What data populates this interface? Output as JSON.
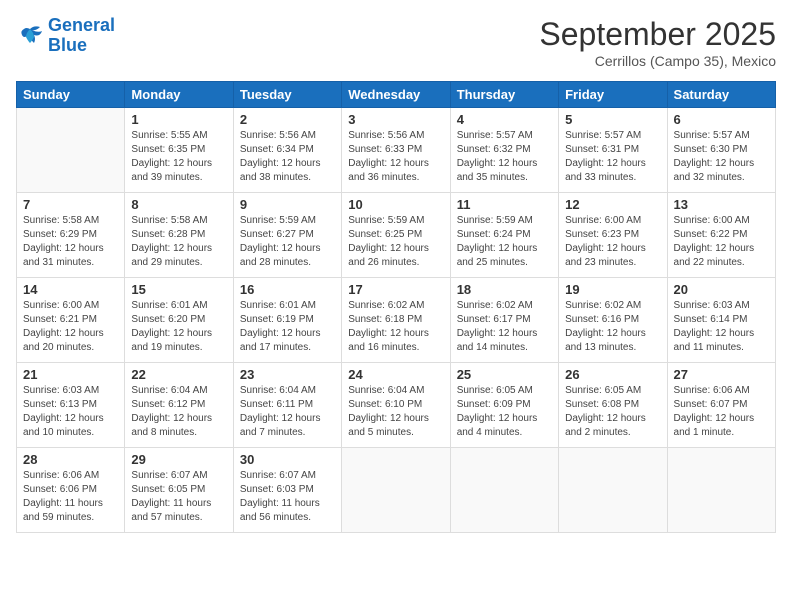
{
  "logo": {
    "line1": "General",
    "line2": "Blue"
  },
  "title": "September 2025",
  "location": "Cerrillos (Campo 35), Mexico",
  "days_header": [
    "Sunday",
    "Monday",
    "Tuesday",
    "Wednesday",
    "Thursday",
    "Friday",
    "Saturday"
  ],
  "weeks": [
    [
      {
        "day": "",
        "info": ""
      },
      {
        "day": "1",
        "info": "Sunrise: 5:55 AM\nSunset: 6:35 PM\nDaylight: 12 hours\nand 39 minutes."
      },
      {
        "day": "2",
        "info": "Sunrise: 5:56 AM\nSunset: 6:34 PM\nDaylight: 12 hours\nand 38 minutes."
      },
      {
        "day": "3",
        "info": "Sunrise: 5:56 AM\nSunset: 6:33 PM\nDaylight: 12 hours\nand 36 minutes."
      },
      {
        "day": "4",
        "info": "Sunrise: 5:57 AM\nSunset: 6:32 PM\nDaylight: 12 hours\nand 35 minutes."
      },
      {
        "day": "5",
        "info": "Sunrise: 5:57 AM\nSunset: 6:31 PM\nDaylight: 12 hours\nand 33 minutes."
      },
      {
        "day": "6",
        "info": "Sunrise: 5:57 AM\nSunset: 6:30 PM\nDaylight: 12 hours\nand 32 minutes."
      }
    ],
    [
      {
        "day": "7",
        "info": "Sunrise: 5:58 AM\nSunset: 6:29 PM\nDaylight: 12 hours\nand 31 minutes."
      },
      {
        "day": "8",
        "info": "Sunrise: 5:58 AM\nSunset: 6:28 PM\nDaylight: 12 hours\nand 29 minutes."
      },
      {
        "day": "9",
        "info": "Sunrise: 5:59 AM\nSunset: 6:27 PM\nDaylight: 12 hours\nand 28 minutes."
      },
      {
        "day": "10",
        "info": "Sunrise: 5:59 AM\nSunset: 6:25 PM\nDaylight: 12 hours\nand 26 minutes."
      },
      {
        "day": "11",
        "info": "Sunrise: 5:59 AM\nSunset: 6:24 PM\nDaylight: 12 hours\nand 25 minutes."
      },
      {
        "day": "12",
        "info": "Sunrise: 6:00 AM\nSunset: 6:23 PM\nDaylight: 12 hours\nand 23 minutes."
      },
      {
        "day": "13",
        "info": "Sunrise: 6:00 AM\nSunset: 6:22 PM\nDaylight: 12 hours\nand 22 minutes."
      }
    ],
    [
      {
        "day": "14",
        "info": "Sunrise: 6:00 AM\nSunset: 6:21 PM\nDaylight: 12 hours\nand 20 minutes."
      },
      {
        "day": "15",
        "info": "Sunrise: 6:01 AM\nSunset: 6:20 PM\nDaylight: 12 hours\nand 19 minutes."
      },
      {
        "day": "16",
        "info": "Sunrise: 6:01 AM\nSunset: 6:19 PM\nDaylight: 12 hours\nand 17 minutes."
      },
      {
        "day": "17",
        "info": "Sunrise: 6:02 AM\nSunset: 6:18 PM\nDaylight: 12 hours\nand 16 minutes."
      },
      {
        "day": "18",
        "info": "Sunrise: 6:02 AM\nSunset: 6:17 PM\nDaylight: 12 hours\nand 14 minutes."
      },
      {
        "day": "19",
        "info": "Sunrise: 6:02 AM\nSunset: 6:16 PM\nDaylight: 12 hours\nand 13 minutes."
      },
      {
        "day": "20",
        "info": "Sunrise: 6:03 AM\nSunset: 6:14 PM\nDaylight: 12 hours\nand 11 minutes."
      }
    ],
    [
      {
        "day": "21",
        "info": "Sunrise: 6:03 AM\nSunset: 6:13 PM\nDaylight: 12 hours\nand 10 minutes."
      },
      {
        "day": "22",
        "info": "Sunrise: 6:04 AM\nSunset: 6:12 PM\nDaylight: 12 hours\nand 8 minutes."
      },
      {
        "day": "23",
        "info": "Sunrise: 6:04 AM\nSunset: 6:11 PM\nDaylight: 12 hours\nand 7 minutes."
      },
      {
        "day": "24",
        "info": "Sunrise: 6:04 AM\nSunset: 6:10 PM\nDaylight: 12 hours\nand 5 minutes."
      },
      {
        "day": "25",
        "info": "Sunrise: 6:05 AM\nSunset: 6:09 PM\nDaylight: 12 hours\nand 4 minutes."
      },
      {
        "day": "26",
        "info": "Sunrise: 6:05 AM\nSunset: 6:08 PM\nDaylight: 12 hours\nand 2 minutes."
      },
      {
        "day": "27",
        "info": "Sunrise: 6:06 AM\nSunset: 6:07 PM\nDaylight: 12 hours\nand 1 minute."
      }
    ],
    [
      {
        "day": "28",
        "info": "Sunrise: 6:06 AM\nSunset: 6:06 PM\nDaylight: 11 hours\nand 59 minutes."
      },
      {
        "day": "29",
        "info": "Sunrise: 6:07 AM\nSunset: 6:05 PM\nDaylight: 11 hours\nand 57 minutes."
      },
      {
        "day": "30",
        "info": "Sunrise: 6:07 AM\nSunset: 6:03 PM\nDaylight: 11 hours\nand 56 minutes."
      },
      {
        "day": "",
        "info": ""
      },
      {
        "day": "",
        "info": ""
      },
      {
        "day": "",
        "info": ""
      },
      {
        "day": "",
        "info": ""
      }
    ]
  ]
}
